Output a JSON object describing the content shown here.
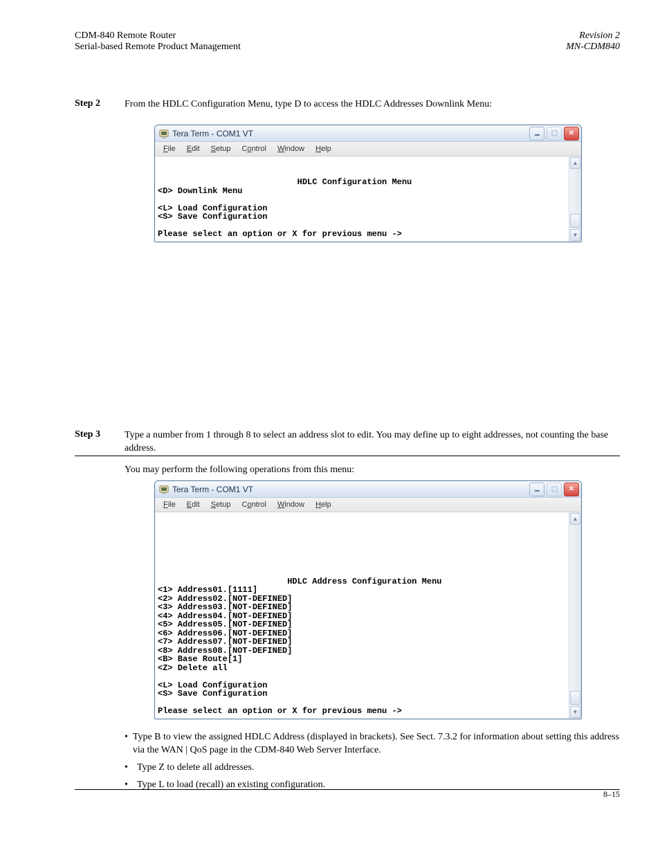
{
  "doc": {
    "header_left": "CDM-840 Remote Router",
    "header_right": "Revision 2",
    "header_sub": "Serial-based Remote Product Management",
    "header_code": "MN-CDM840",
    "step2_label": "Step 2",
    "step2_text": "From the HDLC Configuration Menu, type D to access the HDLC Addresses Downlink Menu:",
    "step3_label": "Step 3",
    "step3_body1": "Type a number from 1 through 8 to select an address slot to edit. You may define up to eight addresses, not counting the base address.",
    "step3_body2": "You may perform the following operations from this menu:",
    "line_bullet1": "Type B to view the assigned HDLC Address (displayed in brackets). See Sect. 7.3.2 for information about setting this address via the WAN | QoS page in the CDM-840 Web Server Interface.",
    "line_bullet2": "Type Z to delete all addresses.",
    "line_bullet3": "Type L to load (recall) an existing configuration.",
    "footer_left": "",
    "footer_right": "8–15"
  },
  "term": {
    "title": "Tera Term - COM1 VT",
    "menus": [
      "File",
      "Edit",
      "Setup",
      "Control",
      "Window",
      "Help"
    ],
    "win1": {
      "heading": "HDLC Configuration Menu",
      "lines": [
        "<D> Downlink Menu",
        "",
        "<L> Load Configuration",
        "<S> Save Configuration",
        "",
        "Please select an option or X for previous menu ->"
      ]
    },
    "win2": {
      "heading": "HDLC Address Configuration Menu",
      "lines": [
        "<1> Address01.[1111]",
        "<2> Address02.[NOT-DEFINED]",
        "<3> Address03.[NOT-DEFINED]",
        "<4> Address04.[NOT-DEFINED]",
        "<5> Address05.[NOT-DEFINED]",
        "<6> Address06.[NOT-DEFINED]",
        "<7> Address07.[NOT-DEFINED]",
        "<8> Address08.[NOT-DEFINED]",
        "<B> Base Route[1]",
        "<Z> Delete all",
        "",
        "<L> Load Configuration",
        "<S> Save Configuration",
        "",
        "Please select an option or X for previous menu ->"
      ]
    }
  }
}
